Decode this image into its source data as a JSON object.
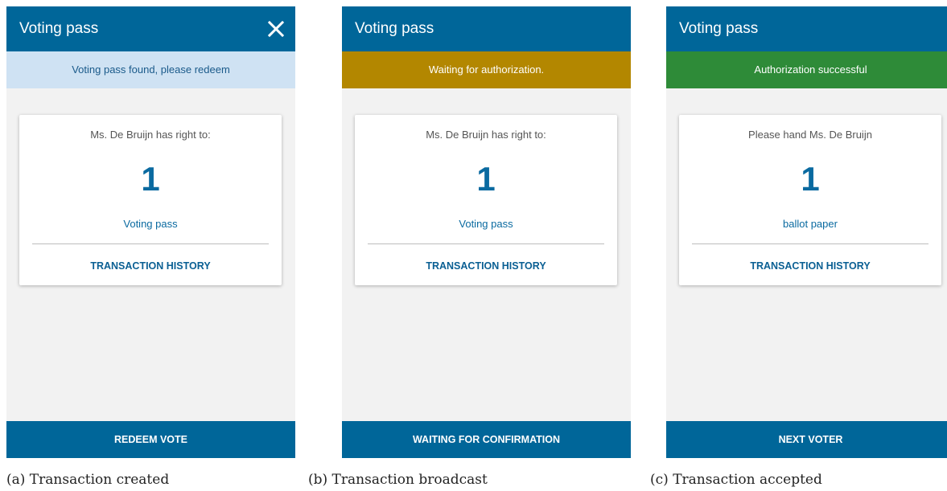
{
  "colors": {
    "appbar": "#006699",
    "banner_info_bg": "#cfe2f3",
    "banner_info_text": "#1a5a8a",
    "banner_waiting_bg": "#b38700",
    "banner_success_bg": "#2e8b38",
    "accent_text": "#0a6aa0",
    "screen_bg": "#f2f2f2"
  },
  "screens": [
    {
      "appbar_title": "Voting pass",
      "close_icon": "close-icon",
      "banner_text": "Voting pass found, please redeem",
      "card": {
        "intro": "Ms. De  Bruijn has right to:",
        "count": "1",
        "unit": "Voting pass",
        "history_label": "TRANSACTION HISTORY"
      },
      "button_label": "REDEEM VOTE",
      "caption": "(a) Transaction created"
    },
    {
      "appbar_title": "Voting pass",
      "banner_text": "Waiting for authorization.",
      "card": {
        "intro": "Ms. De  Bruijn has right to:",
        "count": "1",
        "unit": "Voting pass",
        "history_label": "TRANSACTION HISTORY"
      },
      "button_label": "WAITING FOR CONFIRMATION",
      "caption": "(b) Transaction broadcast"
    },
    {
      "appbar_title": "Voting pass",
      "banner_text": "Authorization successful",
      "card": {
        "intro": "Please hand Ms. De  Bruijn",
        "count": "1",
        "unit": "ballot paper",
        "history_label": "TRANSACTION HISTORY"
      },
      "button_label": "NEXT VOTER",
      "caption": "(c) Transaction accepted"
    }
  ]
}
